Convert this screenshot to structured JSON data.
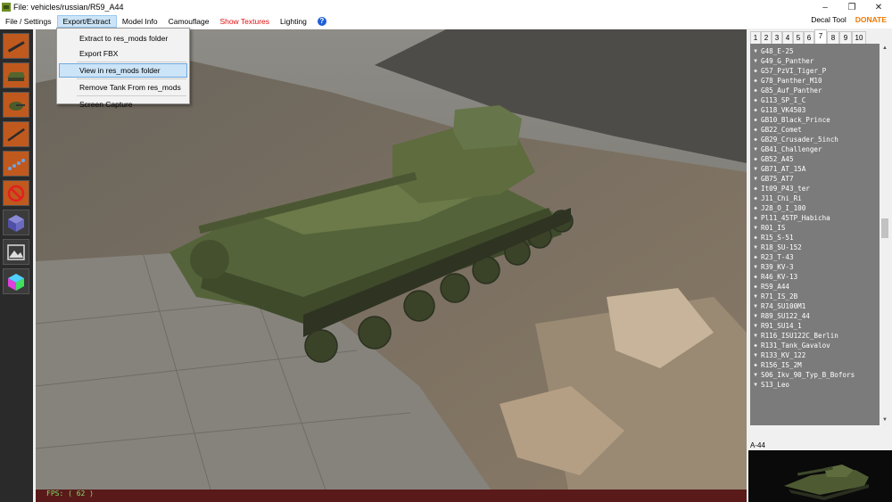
{
  "window": {
    "title": "File: vehicles/russian/R59_A44",
    "controls": [
      "minimize-icon",
      "maximize-icon",
      "close-icon"
    ]
  },
  "menu": {
    "items": [
      {
        "label": "File / Settings"
      },
      {
        "label": "Export/Extract"
      },
      {
        "label": "Model Info"
      },
      {
        "label": "Camouflage"
      },
      {
        "label": "Show Textures"
      },
      {
        "label": "Lighting"
      }
    ],
    "help_icon": "?",
    "decal_tool": "Decal Tool",
    "donate": "DONATE",
    "colors": {
      "show_textures": "#e01010",
      "donate": "#f07800"
    }
  },
  "export_menu": {
    "items": [
      {
        "label": "Extract to res_mods folder"
      },
      {
        "label": "Export FBX"
      },
      {
        "label": "View in res_mods folder"
      },
      {
        "label": "Remove Tank From res_mods"
      },
      {
        "label": "Screen Capture"
      }
    ]
  },
  "toolbar": {
    "tools": [
      {
        "icon": "gun-icon"
      },
      {
        "icon": "hull-icon"
      },
      {
        "icon": "turret-icon"
      },
      {
        "icon": "barrel-icon"
      },
      {
        "icon": "tracks-icon"
      },
      {
        "icon": "no-camo-icon"
      },
      {
        "icon": "cube-icon"
      },
      {
        "icon": "image-icon"
      },
      {
        "icon": "color-cube-icon"
      }
    ]
  },
  "viewport": {
    "fps": "FPS: ( 62 )"
  },
  "tabs": [
    {
      "label": "1"
    },
    {
      "label": "2"
    },
    {
      "label": "3"
    },
    {
      "label": "4"
    },
    {
      "label": "5"
    },
    {
      "label": "6"
    },
    {
      "label": "7"
    },
    {
      "label": "8"
    },
    {
      "label": "9"
    },
    {
      "label": "10"
    }
  ],
  "tank_list": [
    {
      "name": "G48_E-25",
      "mark": "▼"
    },
    {
      "name": "G49_G_Panther",
      "mark": "▼"
    },
    {
      "name": "G57_PzVI_Tiger_P",
      "mark": "◆"
    },
    {
      "name": "G78_Panther_M10",
      "mark": "◆"
    },
    {
      "name": "G85_Auf_Panther",
      "mark": "◆"
    },
    {
      "name": "G113_SP_I_C",
      "mark": "◆"
    },
    {
      "name": "G118_VK4503",
      "mark": "◆"
    },
    {
      "name": "GB10_Black_Prince",
      "mark": "◆"
    },
    {
      "name": "GB22_Comet",
      "mark": "◆"
    },
    {
      "name": "GB29_Crusader_5inch",
      "mark": "◆"
    },
    {
      "name": "GB41_Challenger",
      "mark": "▼"
    },
    {
      "name": "GB52_A45",
      "mark": "◆"
    },
    {
      "name": "GB71_AT_15A",
      "mark": "▼"
    },
    {
      "name": "GB75_AT7",
      "mark": "▼"
    },
    {
      "name": "It09_P43_ter",
      "mark": "◆"
    },
    {
      "name": "J11_Chi_Ri",
      "mark": "◆"
    },
    {
      "name": "J28_O_I_100",
      "mark": "◆"
    },
    {
      "name": "Pl11_45TP_Habicha",
      "mark": "◆"
    },
    {
      "name": "R01_IS",
      "mark": "▼"
    },
    {
      "name": "R15_S-51",
      "mark": "◆"
    },
    {
      "name": "R18_SU-152",
      "mark": "▼"
    },
    {
      "name": "R23_T-43",
      "mark": "◆"
    },
    {
      "name": "R39_KV-3",
      "mark": "▼"
    },
    {
      "name": "R46_KV-13",
      "mark": "◆"
    },
    {
      "name": "R59_A44",
      "mark": "◆"
    },
    {
      "name": "R71_IS_2B",
      "mark": "▼"
    },
    {
      "name": "R74_SU100M1",
      "mark": "▼"
    },
    {
      "name": "R89_SU122_44",
      "mark": "▼"
    },
    {
      "name": "R91_SU14_1",
      "mark": "▼"
    },
    {
      "name": "R116_ISU122C_Berlin",
      "mark": "▼"
    },
    {
      "name": "R131_Tank_Gavalov",
      "mark": "◆"
    },
    {
      "name": "R133_KV_122",
      "mark": "▼"
    },
    {
      "name": "R156_IS_2M",
      "mark": "◆"
    },
    {
      "name": "S06_Ikv_90_Typ_B_Bofors",
      "mark": "▼"
    },
    {
      "name": "S13_Leo",
      "mark": "▼"
    }
  ],
  "preview": {
    "label": "A-44"
  }
}
